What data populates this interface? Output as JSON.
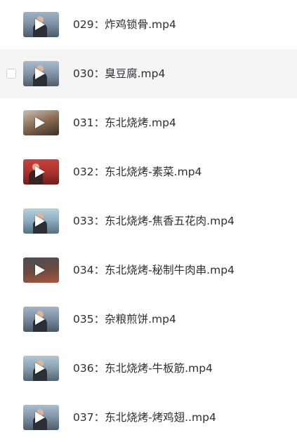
{
  "files": [
    {
      "name": "029：炸鸡锁骨.mp4",
      "icon": "video-thumbnail-icon",
      "scene": "city",
      "selected": false
    },
    {
      "name": "030：臭豆腐.mp4",
      "icon": "video-thumbnail-icon",
      "scene": "city",
      "selected": false,
      "hovered": true
    },
    {
      "name": "031：东北烧烤.mp4",
      "icon": "video-thumbnail-icon",
      "scene": "food",
      "selected": false
    },
    {
      "name": "032：东北烧烤-素菜.mp4",
      "icon": "video-thumbnail-icon",
      "scene": "red",
      "selected": false
    },
    {
      "name": "033：东北烧烤-焦香五花肉.mp4",
      "icon": "video-thumbnail-icon",
      "scene": "city",
      "selected": false
    },
    {
      "name": "034：东北烧烤-秘制牛肉串.mp4",
      "icon": "video-thumbnail-icon",
      "scene": "grill",
      "selected": false
    },
    {
      "name": "035：杂粮煎饼.mp4",
      "icon": "video-thumbnail-icon",
      "scene": "city",
      "selected": false
    },
    {
      "name": "036：东北烧烤-牛板筋.mp4",
      "icon": "video-thumbnail-icon",
      "scene": "city",
      "selected": false
    },
    {
      "name": "037：东北烧烤-烤鸡翅..mp4",
      "icon": "video-thumbnail-icon",
      "scene": "city",
      "selected": false
    }
  ],
  "colors": {
    "hover_background": "#f5f5f6",
    "text": "#2f2f33",
    "checkbox_border": "#d3d3d6"
  }
}
